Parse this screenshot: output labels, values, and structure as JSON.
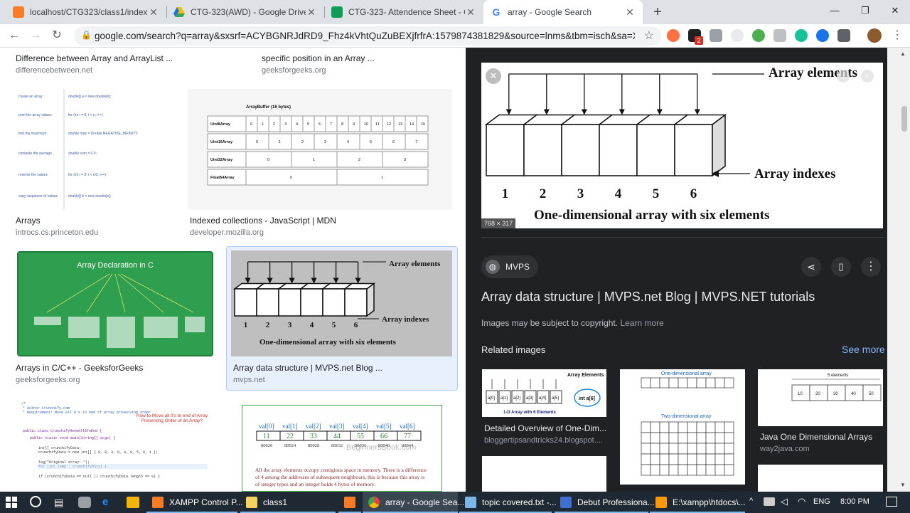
{
  "browser": {
    "tabs": [
      {
        "title": "localhost/CTG323/class1/index.p",
        "icon": "xampp-icon"
      },
      {
        "title": "CTG-323(AWD) - Google Drive",
        "icon": "drive-icon"
      },
      {
        "title": "CTG-323- Attendence Sheet - Go",
        "icon": "sheets-icon"
      },
      {
        "title": "array - Google Search",
        "icon": "google-icon"
      }
    ],
    "new_tab": "+",
    "url": "google.com/search?q=array&sxsrf=ACYBGNRJdRD9_Fhz4kVhtQuZuBEXjfrfrA:1579874381829&source=lnms&tbm=isch&sa=X&v...",
    "ext_badge": "2"
  },
  "results": {
    "row0": [
      {
        "caption": "Difference between Array and ArrayList ...",
        "source": "differencebetween.net"
      },
      {
        "caption": "specific position in an Array ...",
        "source": "geeksforgeeks.org"
      }
    ],
    "row1": [
      {
        "caption": "Arrays",
        "source": "introcs.cs.princeton.edu"
      },
      {
        "caption": "Indexed collections - JavaScript | MDN",
        "source": "developer.mozilla.org"
      }
    ],
    "row2": [
      {
        "caption": "Arrays in C/C++ - GeeksforGeeks",
        "source": "geeksforgeeks.org"
      },
      {
        "caption": "Array data structure | MVPS.net Blog ...",
        "source": "mvps.net"
      }
    ],
    "thumb_texts": {
      "arraybuffer_title": "ArrayBuffer (16 bytes)",
      "arraybuffer_rows": [
        "Uint8Array",
        "Uint16Array",
        "Uint32Array",
        "Float64Array"
      ],
      "arraybuffer_cells": [
        "0",
        "1",
        "2",
        "3",
        "4",
        "5",
        "6",
        "7",
        "8",
        "9",
        "10",
        "11",
        "12",
        "13",
        "14",
        "15"
      ],
      "uint16_cells": [
        "0",
        "1",
        "2",
        "3",
        "4",
        "5",
        "6",
        "7"
      ],
      "uint32_cells": [
        "0",
        "1",
        "2",
        "3"
      ],
      "float64_cells": [
        "0",
        "1"
      ],
      "geeks_title": "Array Declaration in C",
      "mvps_elements": "Array elements",
      "mvps_indexes": "Array indexes",
      "mvps_caption": "One-dimensional array with six elements",
      "mvps_index_values": [
        "1",
        "2",
        "3",
        "4",
        "5",
        "6"
      ],
      "javacode_title": "How to Move all 0's to end of Array Preserving Order of an Array?",
      "val_labels": [
        "val[0]",
        "val[1]",
        "val[2]",
        "val[3]",
        "val[4]",
        "val[5]",
        "val[6]"
      ],
      "val_values": [
        "11",
        "22",
        "33",
        "44",
        "55",
        "66",
        "77"
      ],
      "val_addresses": [
        "80020",
        "80024",
        "80028",
        "80032",
        "80036",
        "80040",
        "80044"
      ],
      "beginners_watermark": "BeginnersBook.com",
      "beginners_text": "All the array elements occupy contigious space in memory. There is a difference of 4 among the addresses of subsequent neighbours, this is because this array is of integer types and an integer holds 4 bytes of memory."
    }
  },
  "preview": {
    "image_size": "768 × 317",
    "array_elements": "Array elements",
    "array_indexes": "Array indexes",
    "caption": "One-dimensional array with six elements",
    "indexes": [
      "1",
      "2",
      "3",
      "4",
      "5",
      "6"
    ],
    "source_name": "MVPS",
    "title": "Array data structure | MVPS.net Blog | MVPS.NET tutorials",
    "copyright": "Images may be subject to copyright.",
    "learn_more": "Learn more",
    "related_heading": "Related images",
    "see_more": "See more",
    "related": [
      {
        "caption": "Detailed Overview of One-Dim...",
        "source": "bloggertipsandtricks24.blogspot....",
        "img_title": "Array Elements",
        "img_sub": "1-D Array with 6 Elements",
        "bubble": "int a[6]",
        "cells": [
          "a[0]",
          "a[1]",
          "a[2]",
          "a[3]",
          "a[4]",
          "a[5]"
        ]
      },
      {
        "caption": "",
        "source": "",
        "img_title": "One-dimensional array",
        "img_sub": "Two-dimensional array"
      },
      {
        "caption": "Java One Dimensional Arrays",
        "source": "way2java.com",
        "img_title": "5 elements",
        "cells": [
          "10",
          "20",
          "30",
          "40",
          "50"
        ]
      }
    ]
  },
  "taskbar": {
    "items": [
      "XAMPP Control P...",
      "class1",
      "",
      "array - Google Sea...",
      "topic covered.txt -...",
      "Debut Professiona...",
      "E:\\xampp\\htdocs\\..."
    ],
    "language": "ENG",
    "time": "8:00 PM"
  }
}
